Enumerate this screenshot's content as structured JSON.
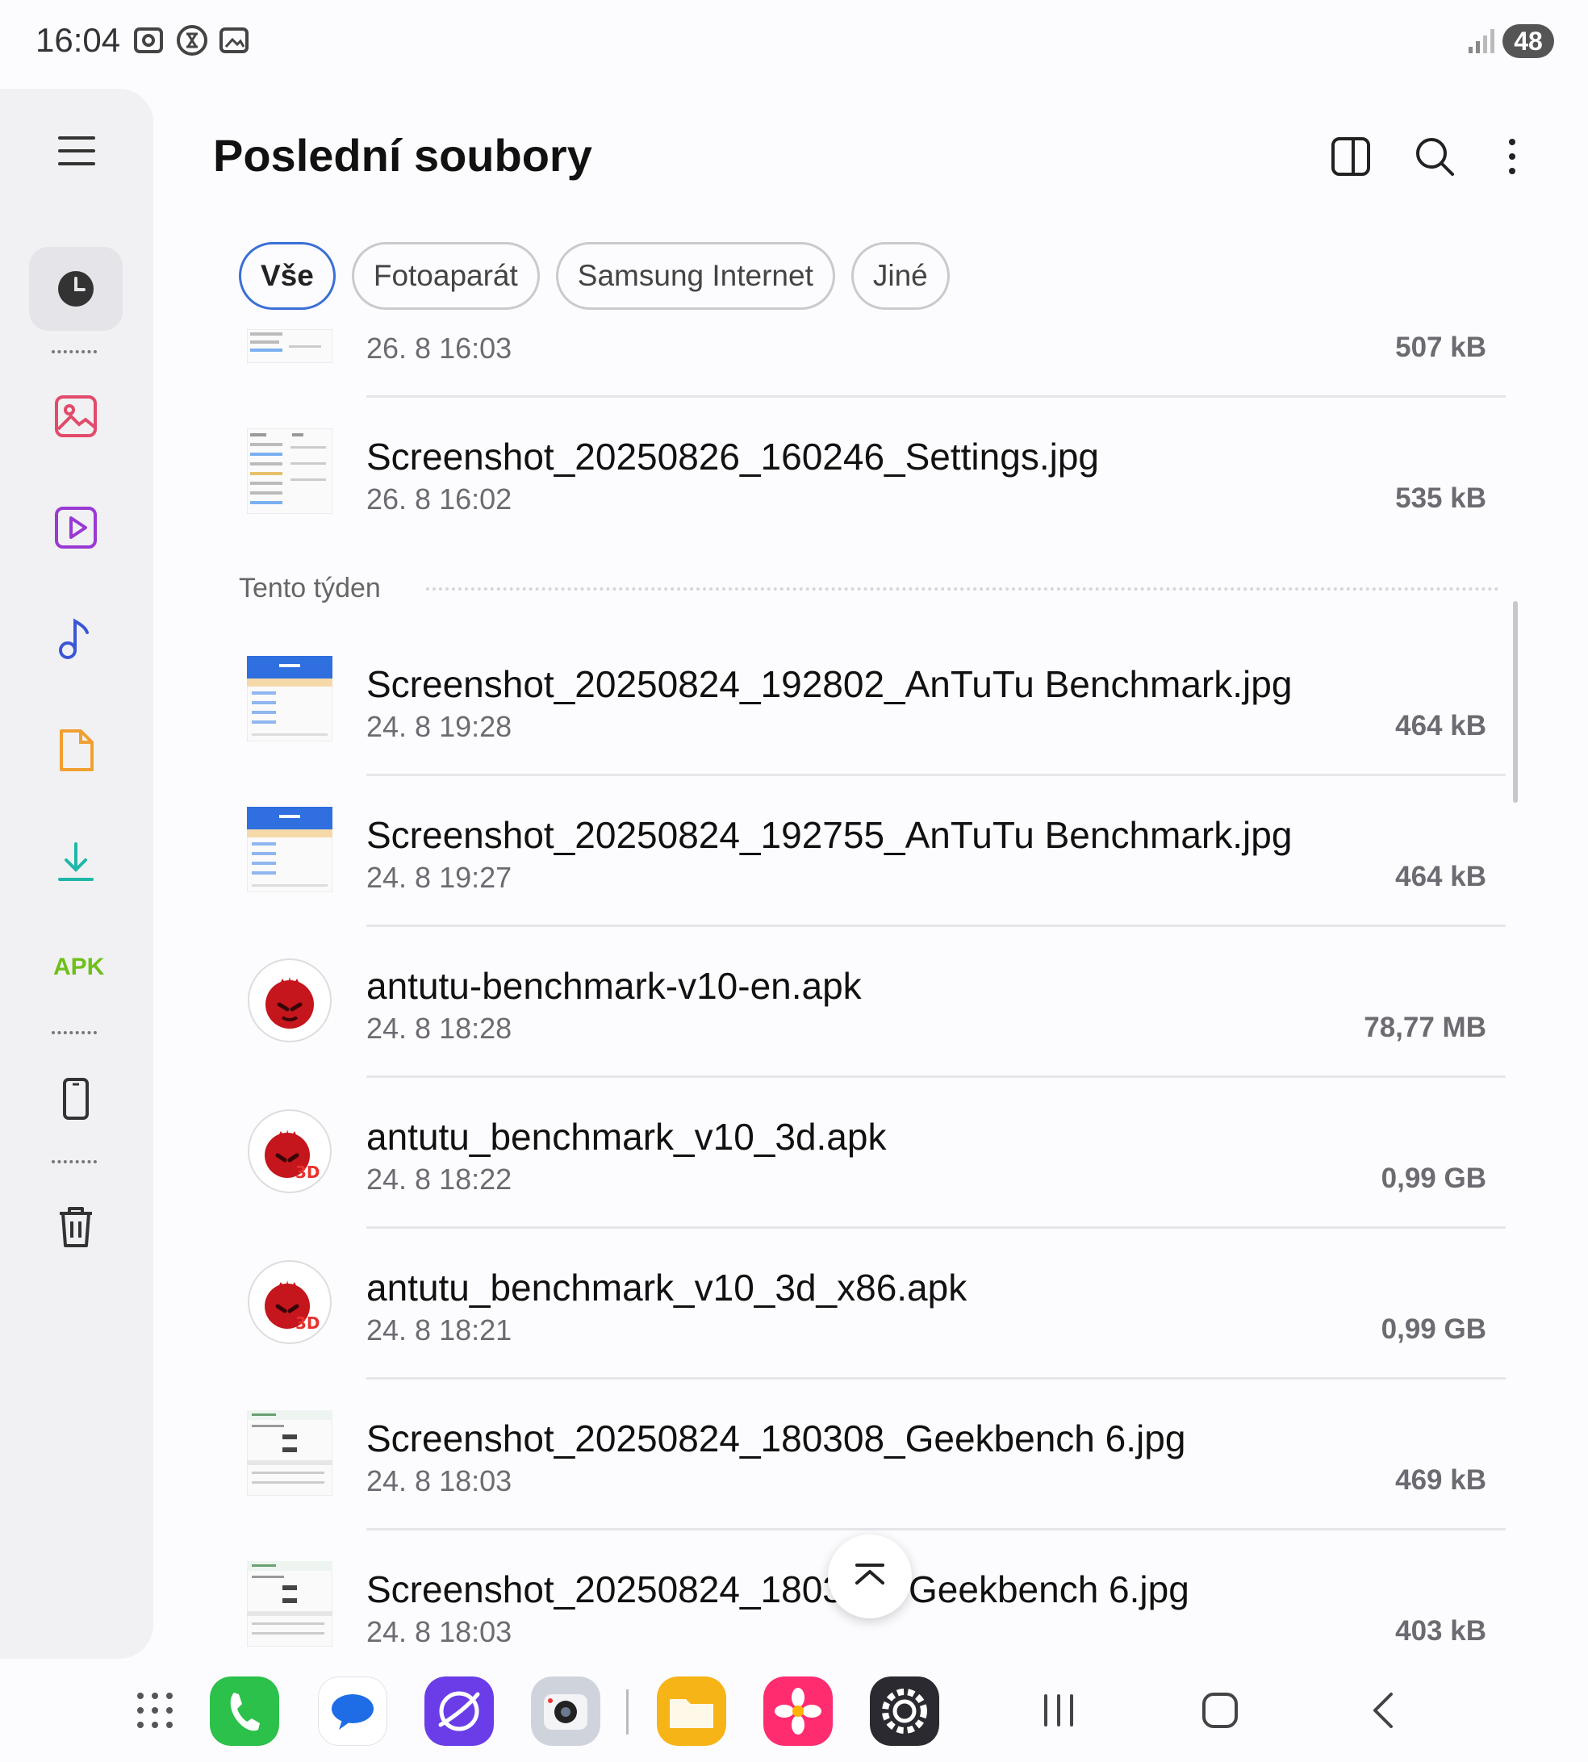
{
  "status_bar": {
    "time": "16:04",
    "battery": "48"
  },
  "header": {
    "title": "Poslední soubory"
  },
  "filters": [
    {
      "label": "Vše",
      "active": true
    },
    {
      "label": "Fotoaparát",
      "active": false
    },
    {
      "label": "Samsung Internet",
      "active": false
    },
    {
      "label": "Jiné",
      "active": false
    }
  ],
  "sidebar": {
    "apk_label": "APK"
  },
  "files_top": [
    {
      "name": "",
      "date": "26. 8 16:03",
      "size": "507 kB",
      "thumb": "screenshot-settings"
    },
    {
      "name": "Screenshot_20250826_160246_Settings.jpg",
      "date": "26. 8 16:02",
      "size": "535 kB",
      "thumb": "screenshot-settings"
    }
  ],
  "section_label": "Tento týden",
  "files_week": [
    {
      "name": "Screenshot_20250824_192802_AnTuTu Benchmark.jpg",
      "date": "24. 8 19:28",
      "size": "464 kB",
      "thumb": "screenshot-antutu"
    },
    {
      "name": "Screenshot_20250824_192755_AnTuTu Benchmark.jpg",
      "date": "24. 8 19:27",
      "size": "464 kB",
      "thumb": "screenshot-antutu"
    },
    {
      "name": "antutu-benchmark-v10-en.apk",
      "date": "24. 8 18:28",
      "size": "78,77 MB",
      "thumb": "antutu-app"
    },
    {
      "name": "antutu_benchmark_v10_3d.apk",
      "date": "24. 8 18:22",
      "size": "0,99 GB",
      "thumb": "antutu-3d-app"
    },
    {
      "name": "antutu_benchmark_v10_3d_x86.apk",
      "date": "24. 8 18:21",
      "size": "0,99 GB",
      "thumb": "antutu-3d-app"
    },
    {
      "name": "Screenshot_20250824_180308_Geekbench 6.jpg",
      "date": "24. 8 18:03",
      "size": "469 kB",
      "thumb": "screenshot-geekbench"
    },
    {
      "name": "Screenshot_20250824_1803",
      "name_tail": "Geekbench 6.jpg",
      "date": "24. 8 18:03",
      "size": "403 kB",
      "thumb": "screenshot-geekbench"
    }
  ],
  "colors": {
    "accent": "#3b6fd6",
    "apk": "#6fbf1a"
  }
}
